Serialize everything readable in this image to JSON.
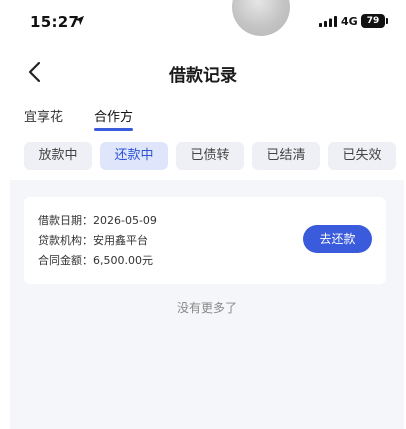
{
  "status_bar": {
    "time": "15:27",
    "network": "4G",
    "battery": "79",
    "icons": [
      "location-arrow-icon",
      "signal-icon",
      "battery-icon"
    ]
  },
  "nav": {
    "title": "借款记录",
    "back_icon": "chevron-left-icon"
  },
  "source_tabs": [
    {
      "label": "宜享花",
      "active": false
    },
    {
      "label": "合作方",
      "active": true
    }
  ],
  "status_chips": [
    {
      "label": "放款中",
      "active": false
    },
    {
      "label": "还款中",
      "active": true
    },
    {
      "label": "已债转",
      "active": false
    },
    {
      "label": "已结清",
      "active": false
    },
    {
      "label": "已失效",
      "active": false
    }
  ],
  "loan_card": {
    "rows": [
      {
        "label": "借款日期：",
        "value": "2026-05-09"
      },
      {
        "label": "贷款机构：",
        "value": "安用鑫平台"
      },
      {
        "label": "合同金额：",
        "value": "6,500.00元"
      }
    ],
    "action_label": "去还款"
  },
  "footer_text": "没有更多了",
  "colors": {
    "accent": "#3a5bdc",
    "chip_active_bg": "#dfe6fb",
    "chip_bg": "#eef0f5",
    "content_bg": "#f5f6fa"
  }
}
